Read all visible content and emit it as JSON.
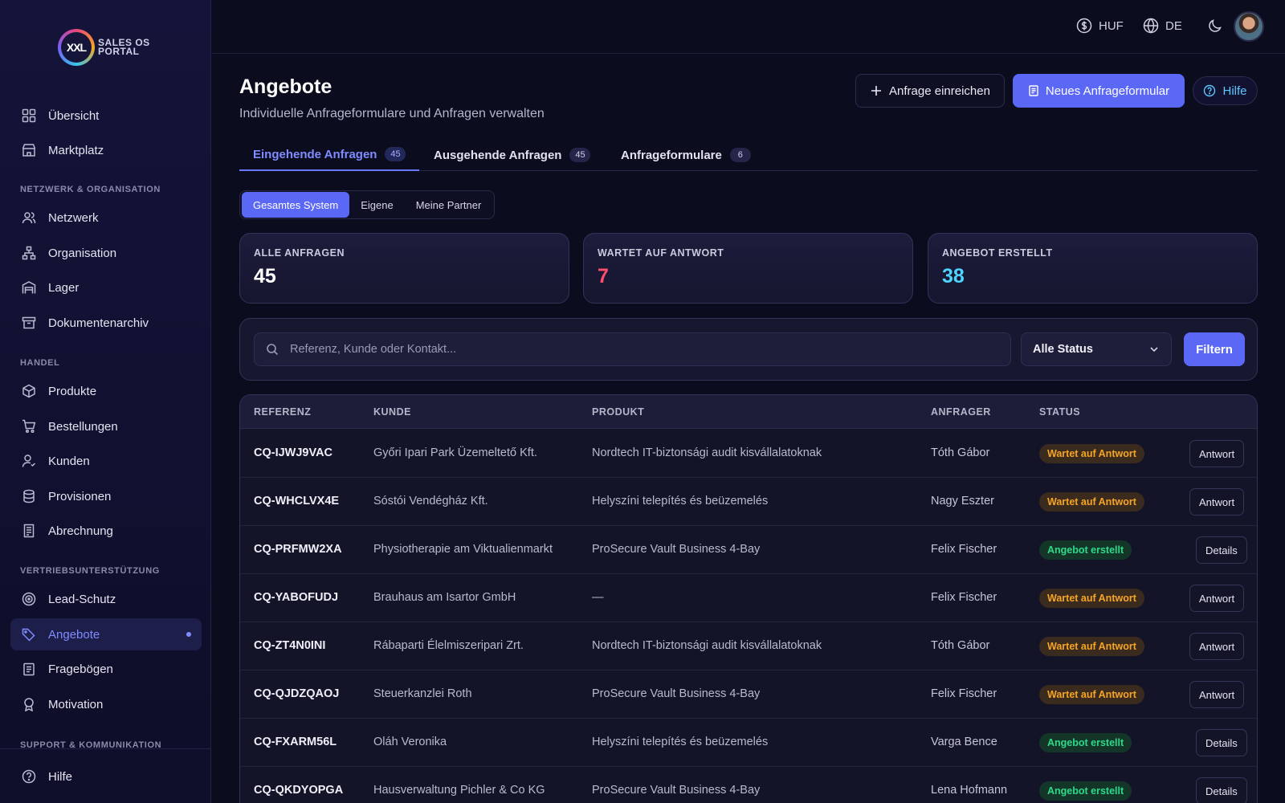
{
  "brand": {
    "mark": "XXL",
    "line1": "SALES OS",
    "line2": "PORTAL"
  },
  "sidebar": {
    "items": [
      {
        "label": "Übersicht",
        "icon": "grid-icon"
      },
      {
        "label": "Marktplatz",
        "icon": "store-icon"
      },
      {
        "label": "Netzwerk",
        "icon": "users-icon"
      },
      {
        "label": "Organisation",
        "icon": "org-chart-icon"
      },
      {
        "label": "Lager",
        "icon": "warehouse-icon"
      },
      {
        "label": "Dokumentenarchiv",
        "icon": "archive-icon"
      },
      {
        "label": "Produkte",
        "icon": "box-icon"
      },
      {
        "label": "Bestellungen",
        "icon": "cart-icon"
      },
      {
        "label": "Kunden",
        "icon": "user-icon"
      },
      {
        "label": "Provisionen",
        "icon": "database-icon"
      },
      {
        "label": "Abrechnung",
        "icon": "receipt-icon"
      },
      {
        "label": "Lead-Schutz",
        "icon": "target-icon"
      },
      {
        "label": "Angebote",
        "icon": "tag-icon"
      },
      {
        "label": "Fragebögen",
        "icon": "clipboard-icon"
      },
      {
        "label": "Motivation",
        "icon": "award-icon"
      }
    ],
    "sections": [
      "NETZWERK & ORGANISATION",
      "HANDEL",
      "VERTRIEBSUNTERSTÜTZUNG",
      "SUPPORT & KOMMUNIKATION"
    ],
    "footer": {
      "label": "Hilfe",
      "icon": "help-circle-icon"
    }
  },
  "topbar": {
    "currency": "HUF",
    "language": "DE"
  },
  "page": {
    "title": "Angebote",
    "subtitle": "Individuelle Anfrageformulare und Anfragen verwalten",
    "btn_submit": "Anfrage einreichen",
    "btn_new": "Neues Anfrageformular",
    "btn_help": "Hilfe"
  },
  "tabs": [
    {
      "label": "Eingehende Anfragen",
      "count": "45"
    },
    {
      "label": "Ausgehende Anfragen",
      "count": "45"
    },
    {
      "label": "Anfrageformulare",
      "count": "6"
    }
  ],
  "scope": [
    "Gesamtes System",
    "Eigene",
    "Meine Partner"
  ],
  "stats": [
    {
      "label": "ALLE ANFRAGEN",
      "value": "45",
      "color": "#ffffff"
    },
    {
      "label": "WARTET AUF ANTWORT",
      "value": "7",
      "color": "#ff4d6d"
    },
    {
      "label": "ANGEBOT ERSTELLT",
      "value": "38",
      "color": "#4fd3ff"
    }
  ],
  "filters": {
    "search_placeholder": "Referenz, Kunde oder Kontakt...",
    "status_value": "Alle Status",
    "filter_label": "Filtern"
  },
  "table": {
    "headers": [
      "REFERENZ",
      "KUNDE",
      "PRODUKT",
      "ANFRAGER",
      "STATUS"
    ],
    "rows": [
      {
        "ref": "CQ-IJWJ9VAC",
        "customer": "Győri Ipari Park Üzemeltető Kft.",
        "product": "Nordtech IT-biztonsági audit kisvállalatoknak",
        "requester": "Tóth Gábor",
        "status": "Wartet auf Antwort",
        "kind": "wait",
        "action": "Antwort"
      },
      {
        "ref": "CQ-WHCLVX4E",
        "customer": "Sóstói Vendégház Kft.",
        "product": "Helyszíni telepítés és beüzemelés",
        "requester": "Nagy Eszter",
        "status": "Wartet auf Antwort",
        "kind": "wait",
        "action": "Antwort"
      },
      {
        "ref": "CQ-PRFMW2XA",
        "customer": "Physiotherapie am Viktualienmarkt",
        "product": "ProSecure Vault Business 4-Bay",
        "requester": "Felix Fischer",
        "status": "Angebot erstellt",
        "kind": "done",
        "action": "Details"
      },
      {
        "ref": "CQ-YABOFUDJ",
        "customer": "Brauhaus am Isartor GmbH",
        "product": "—",
        "requester": "Felix Fischer",
        "status": "Wartet auf Antwort",
        "kind": "wait",
        "action": "Antwort"
      },
      {
        "ref": "CQ-ZT4N0INI",
        "customer": "Rábaparti Élelmiszeripari Zrt.",
        "product": "Nordtech IT-biztonsági audit kisvállalatoknak",
        "requester": "Tóth Gábor",
        "status": "Wartet auf Antwort",
        "kind": "wait",
        "action": "Antwort"
      },
      {
        "ref": "CQ-QJDZQAOJ",
        "customer": "Steuerkanzlei Roth",
        "product": "ProSecure Vault Business 4-Bay",
        "requester": "Felix Fischer",
        "status": "Wartet auf Antwort",
        "kind": "wait",
        "action": "Antwort"
      },
      {
        "ref": "CQ-FXARM56L",
        "customer": "Oláh Veronika",
        "product": "Helyszíni telepítés és beüzemelés",
        "requester": "Varga Bence",
        "status": "Angebot erstellt",
        "kind": "done",
        "action": "Details"
      },
      {
        "ref": "CQ-QKDYOPGA",
        "customer": "Hausverwaltung Pichler & Co KG",
        "product": "ProSecure Vault Business 4-Bay",
        "requester": "Lena Hofmann",
        "status": "Angebot erstellt",
        "kind": "done",
        "action": "Details"
      }
    ]
  }
}
